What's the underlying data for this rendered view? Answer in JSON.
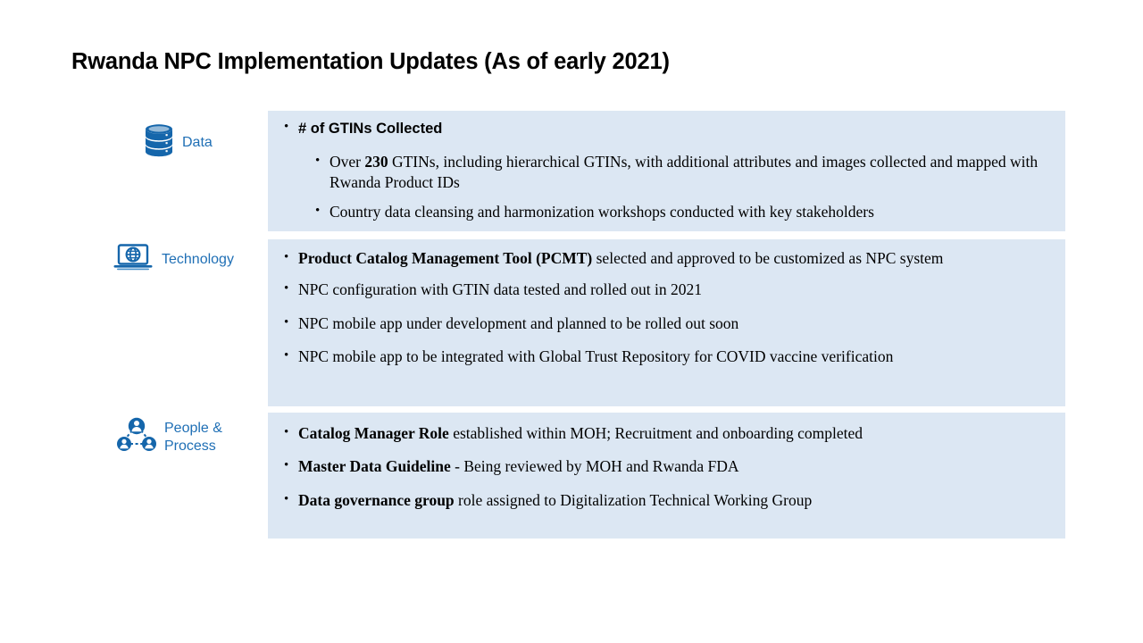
{
  "slide": {
    "title": "Rwanda NPC Implementation Updates (As of early 2021)",
    "panel_bg": "#dce7f3",
    "accent_blue": "#1f6fb5",
    "text_color": "#000000"
  },
  "sections": [
    {
      "id": "data",
      "icon": "database-icon",
      "label": "Data",
      "bullets": [
        {
          "level": 1,
          "bold_lead": "# of GTINs Collected",
          "rest": ""
        },
        {
          "level": 2,
          "pre": "Over ",
          "bold_mid": "230",
          "rest": " GTINs, including hierarchical GTINs,  with additional attributes and images collected and mapped with Rwanda Product IDs"
        },
        {
          "level": 2,
          "pre": "",
          "bold_mid": "",
          "rest": "Country data cleansing and harmonization workshops conducted with key stakeholders"
        }
      ]
    },
    {
      "id": "technology",
      "icon": "laptop-globe-icon",
      "label": "Technology",
      "bullets": [
        {
          "level": 1,
          "bold_lead": "Product Catalog Management Tool (PCMT)",
          "rest": " selected and approved to be customized as NPC system"
        },
        {
          "level": 1,
          "bold_lead": "",
          "rest": "NPC configuration with GTIN data tested and rolled out in 2021"
        },
        {
          "level": 1,
          "bold_lead": "",
          "rest": "NPC mobile app under development and planned to be rolled out soon"
        },
        {
          "level": 1,
          "bold_lead": "",
          "rest": "NPC mobile app to be integrated with Global Trust Repository for COVID vaccine verification"
        }
      ]
    },
    {
      "id": "people",
      "icon": "people-network-icon",
      "label": "People & Process",
      "label_line1": "People &",
      "label_line2": "Process",
      "bullets": [
        {
          "level": 1,
          "bold_lead": "Catalog Manager Role",
          "rest": " established within MOH; Recruitment and onboarding completed"
        },
        {
          "level": 1,
          "bold_lead": "Master Data Guideline",
          "rest": " - Being reviewed by MOH and Rwanda FDA"
        },
        {
          "level": 1,
          "bold_lead": "Data governance group",
          "rest": " role assigned to Digitalization Technical Working Group"
        }
      ]
    }
  ]
}
